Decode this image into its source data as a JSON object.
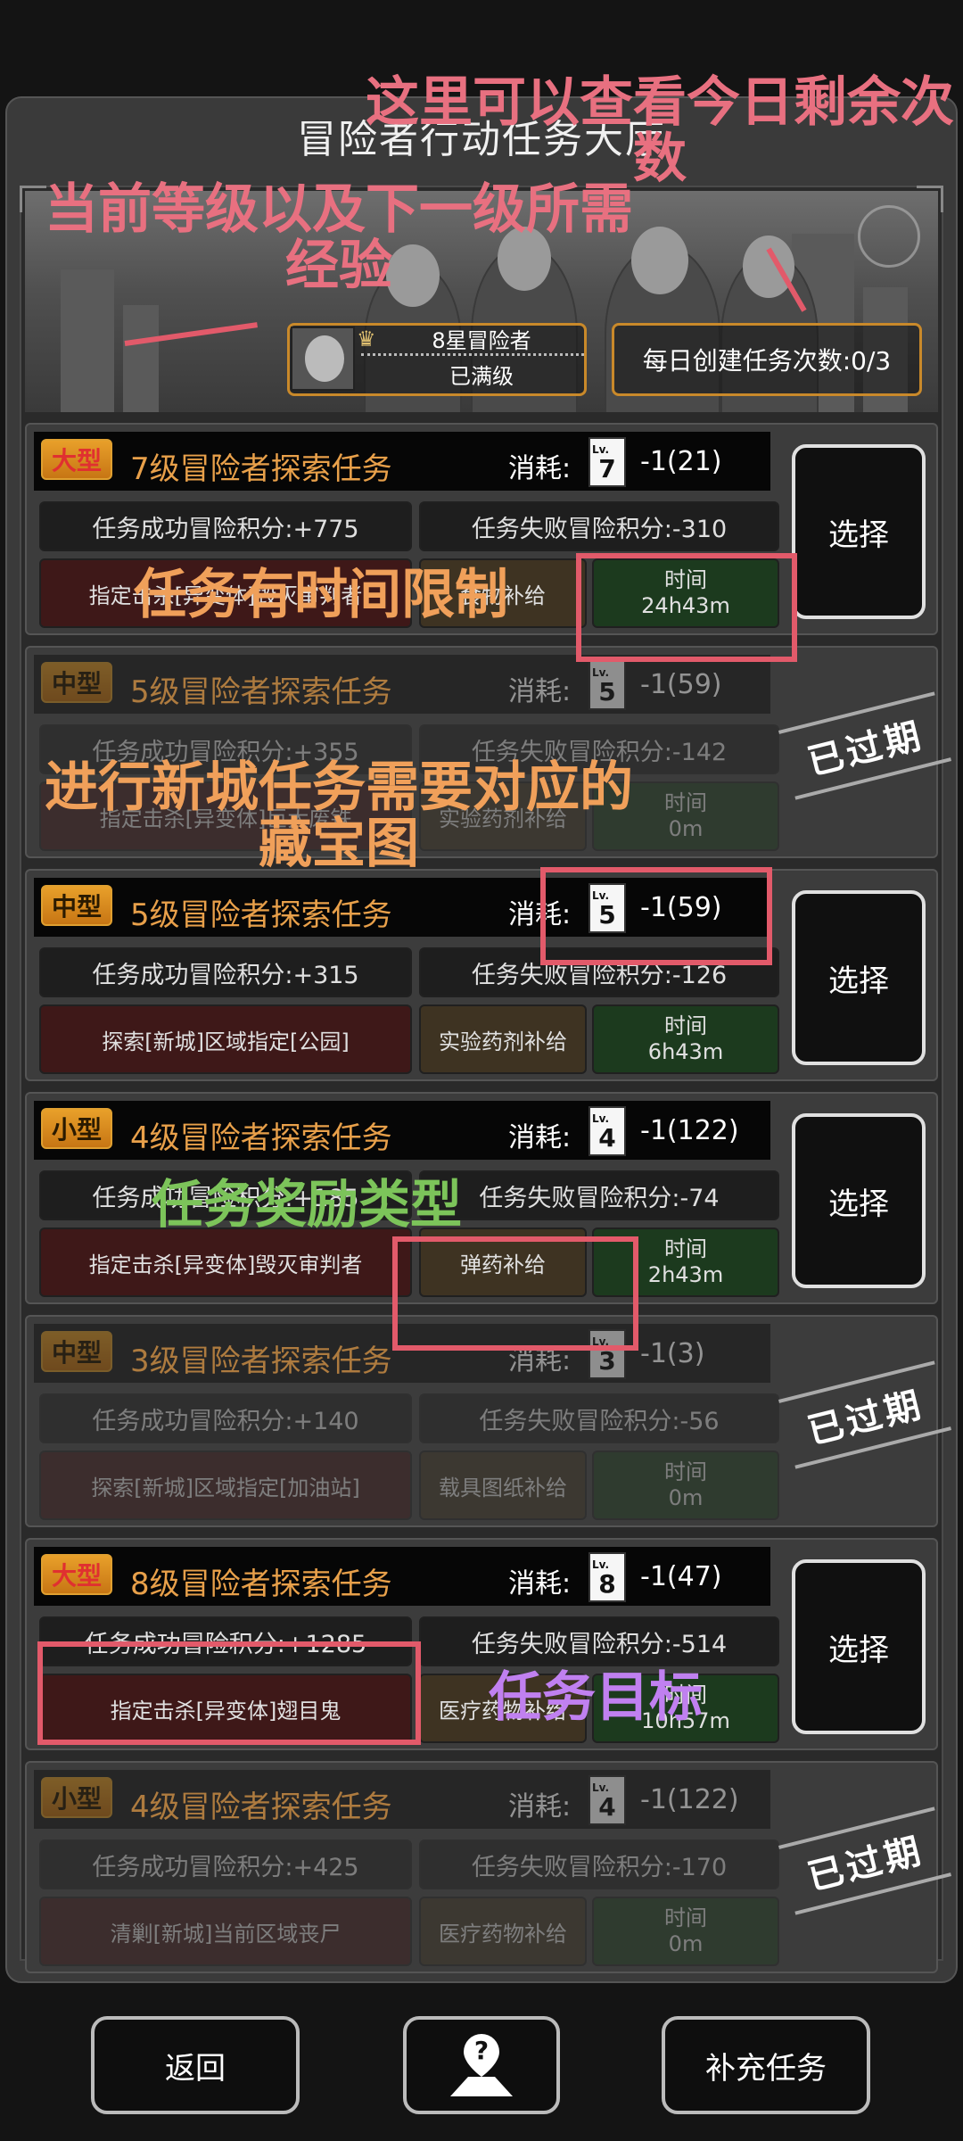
{
  "title": "冒险者行动任务大厅",
  "level": {
    "name": "8星冒险者",
    "status": "已满级"
  },
  "daily_count": "每日创建任务次数:0/3",
  "tasks": [
    {
      "size": "大型",
      "name": "7级冒险者探索任务",
      "cost_label": "消耗:",
      "card": "7",
      "cost": "-1(21)",
      "success": "任务成功冒险积分:+775",
      "fail": "任务失败冒险积分:-310",
      "goal": "指定击杀[异变体]毁灭审判者",
      "reward": "食物补给",
      "time_label": "时间",
      "time": "24h43m",
      "action": "选择"
    },
    {
      "size": "中型",
      "name": "5级冒险者探索任务",
      "cost_label": "消耗:",
      "card": "5",
      "cost": "-1(59)",
      "success": "任务成功冒险积分:+355",
      "fail": "任务失败冒险积分:-142",
      "goal": "指定击杀[异变体]巨大废铁",
      "reward": "实验药剂补给",
      "time_label": "时间",
      "time": "0m",
      "expired": "已过期"
    },
    {
      "size": "中型",
      "name": "5级冒险者探索任务",
      "cost_label": "消耗:",
      "card": "5",
      "cost": "-1(59)",
      "success": "任务成功冒险积分:+315",
      "fail": "任务失败冒险积分:-126",
      "goal": "探索[新城]区域指定[公园]",
      "reward": "实验药剂补给",
      "time_label": "时间",
      "time": "6h43m",
      "action": "选择"
    },
    {
      "size": "小型",
      "name": "4级冒险者探索任务",
      "cost_label": "消耗:",
      "card": "4",
      "cost": "-1(122)",
      "success": "任务成功冒险积分:+185",
      "fail": "任务失败冒险积分:-74",
      "goal": "指定击杀[异变体]毁灭审判者",
      "reward": "弹药补给",
      "time_label": "时间",
      "time": "2h43m",
      "action": "选择"
    },
    {
      "size": "中型",
      "name": "3级冒险者探索任务",
      "cost_label": "消耗:",
      "card": "3",
      "cost": "-1(3)",
      "success": "任务成功冒险积分:+140",
      "fail": "任务失败冒险积分:-56",
      "goal": "探索[新城]区域指定[加油站]",
      "reward": "载具图纸补给",
      "time_label": "时间",
      "time": "0m",
      "expired": "已过期"
    },
    {
      "size": "大型",
      "name": "8级冒险者探索任务",
      "cost_label": "消耗:",
      "card": "8",
      "cost": "-1(47)",
      "success": "任务成功冒险积分:+1285",
      "fail": "任务失败冒险积分:-514",
      "goal": "指定击杀[异变体]翅目鬼",
      "reward": "医疗药物补给",
      "time_label": "时间",
      "time": "10h57m",
      "action": "选择"
    },
    {
      "size": "小型",
      "name": "4级冒险者探索任务",
      "cost_label": "消耗:",
      "card": "4",
      "cost": "-1(122)",
      "success": "任务成功冒险积分:+425",
      "fail": "任务失败冒险积分:-170",
      "goal": "清剿[新城]当前区域丧尸",
      "reward": "医疗药物补给",
      "time_label": "时间",
      "time": "0m",
      "expired": "已过期"
    }
  ],
  "buttons": {
    "back": "返回",
    "help_icon": "help-map-icon",
    "refill": "补充任务"
  },
  "annotations": {
    "a1": "这里可以查看今日剩余次数",
    "a2": "当前等级以及下一级所需经验",
    "a3": "任务有时间限制",
    "a4": "进行新城任务需要对应的藏宝图",
    "a5": "任务奖励类型",
    "a6": "任务目标"
  },
  "colors": {
    "badge": "#e8a02a",
    "big_text": "#e03030",
    "task_name": "#e8a04a",
    "highlight": "#e25a6a"
  }
}
